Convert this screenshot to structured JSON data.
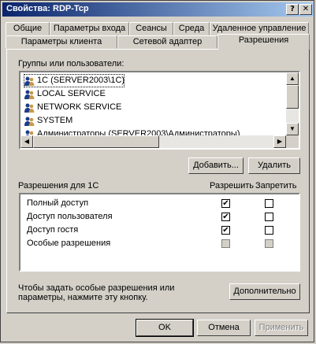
{
  "window": {
    "title": "Свойства: RDP-Tcp",
    "help_glyph": "?",
    "close_glyph": "✕"
  },
  "tabs_row1": [
    "Общие",
    "Параметры входа",
    "Сеансы",
    "Среда",
    "Удаленное управление"
  ],
  "tabs_row2": [
    "Параметры клиента",
    "Сетевой адаптер",
    "Разрешения"
  ],
  "groups": {
    "label": "Группы или пользователи:",
    "items": [
      "1C (SERVER2003\\1C)",
      "LOCAL SERVICE",
      "NETWORK SERVICE",
      "SYSTEM",
      "Администраторы (SERVER2003\\Администраторы)"
    ],
    "selected_index": 0,
    "add_button": "Добавить...",
    "remove_button": "Удалить"
  },
  "permissions": {
    "label": "Разрешения для 1C",
    "allow_header": "Разрешить",
    "deny_header": "Запретить",
    "rows": [
      {
        "name": "Полный доступ",
        "allow": true,
        "deny": false
      },
      {
        "name": "Доступ пользователя",
        "allow": true,
        "deny": false
      },
      {
        "name": "Доступ гостя",
        "allow": true,
        "deny": false
      },
      {
        "name": "Особые разрешения",
        "allow": false,
        "deny": false
      }
    ],
    "special_note": "Чтобы задать особые разрешения или параметры, нажмите эту кнопку.",
    "advanced_button": "Дополнительно"
  },
  "footer": {
    "ok": "OK",
    "cancel": "Отмена",
    "apply": "Применить"
  },
  "icons": {
    "scroll_up": "▲",
    "scroll_down": "▼",
    "scroll_left": "◀",
    "scroll_right": "▶",
    "check": "✔"
  }
}
